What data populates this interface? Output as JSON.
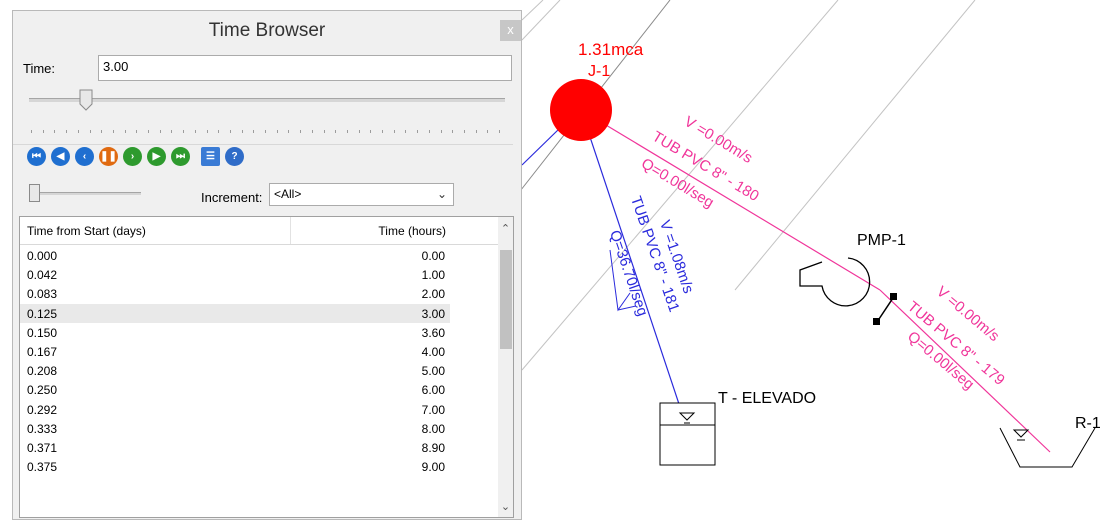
{
  "window": {
    "title": "Time Browser",
    "close_label": "x"
  },
  "time_field": {
    "label": "Time:",
    "value": "3.00"
  },
  "time_slider": {
    "fraction": 0.12
  },
  "controls": [
    {
      "name": "first-icon",
      "color": "#1f6fd0",
      "glyph": "⏮"
    },
    {
      "name": "rewind-icon",
      "color": "#1f6fd0",
      "glyph": "◀"
    },
    {
      "name": "step-back-icon",
      "color": "#1f6fd0",
      "glyph": "‹"
    },
    {
      "name": "pause-icon",
      "color": "#e06a10",
      "glyph": "❚❚"
    },
    {
      "name": "step-forward-icon",
      "color": "#2e9a2e",
      "glyph": "›"
    },
    {
      "name": "play-icon",
      "color": "#2e9a2e",
      "glyph": "▶"
    },
    {
      "name": "last-icon",
      "color": "#2e9a2e",
      "glyph": "⏭"
    },
    {
      "name": "list-icon",
      "color": "#3a7bd5",
      "glyph": "☰"
    },
    {
      "name": "help-icon",
      "color": "#2f6cc8",
      "glyph": "?"
    }
  ],
  "increment": {
    "label": "Increment:",
    "value": "<All>"
  },
  "table": {
    "col1": "Time from Start (days)",
    "col2": "Time (hours)",
    "rows": [
      [
        "0.000",
        "0.00"
      ],
      [
        "0.042",
        "1.00"
      ],
      [
        "0.083",
        "2.00"
      ],
      [
        "0.125",
        "3.00"
      ],
      [
        "0.150",
        "3.60"
      ],
      [
        "0.167",
        "4.00"
      ],
      [
        "0.208",
        "5.00"
      ],
      [
        "0.250",
        "6.00"
      ],
      [
        "0.292",
        "7.00"
      ],
      [
        "0.333",
        "8.00"
      ],
      [
        "0.371",
        "8.90"
      ],
      [
        "0.375",
        "9.00"
      ]
    ],
    "selected_row": 3
  },
  "network": {
    "junction_pressure": "1.31mca",
    "junction_id": "J-1",
    "pipe180": {
      "velocity": "V =0.00m/s",
      "name": "TUB PVC 8\" - 180",
      "flow": "Q=0.00l/seg"
    },
    "pipe181": {
      "velocity": "V =1.08m/s",
      "name": "TUB PVC 8\" - 181",
      "flow": "Q=36.70l/seg"
    },
    "pipe179": {
      "velocity": "V =0.00m/s",
      "name": "TUB PVC 8\" - 179",
      "flow": "Q=0.00l/seg"
    },
    "pump": "PMP-1",
    "tank": "T - ELEVADO",
    "reservoir": "R-1",
    "colors": {
      "red": "#ff0000",
      "pink": "#f0359a",
      "blue": "#2b2bdc",
      "gray": "#bdbdbd"
    }
  }
}
